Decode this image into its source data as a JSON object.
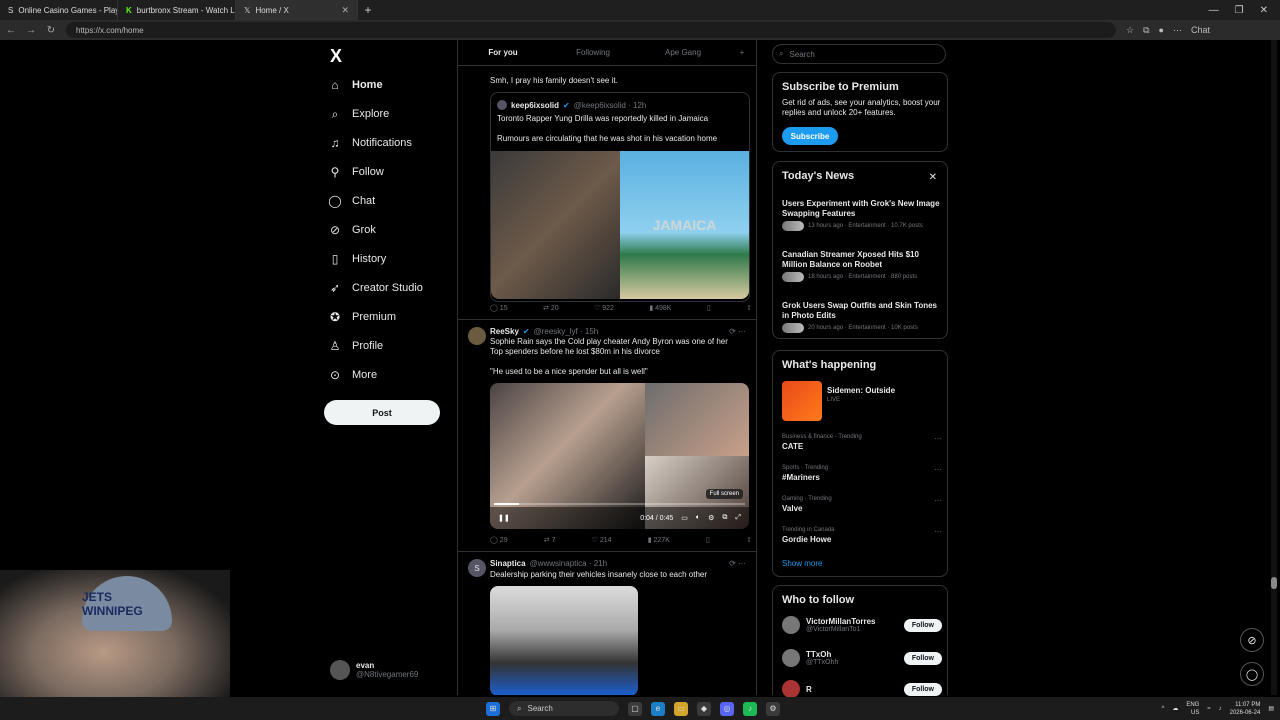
{
  "browser": {
    "tabs": [
      {
        "label": "Online Casino Games - Play Free !",
        "icon": "s-icon"
      },
      {
        "label": "burtbronx Stream - Watch Li...",
        "icon": "kick-icon"
      },
      {
        "label": "Home / X",
        "icon": "x-icon"
      }
    ],
    "url": "https://x.com/home",
    "chat_label": "Chat"
  },
  "sidebar": {
    "logo": "X",
    "items": [
      {
        "label": "Home",
        "icon": "home-icon"
      },
      {
        "label": "Explore",
        "icon": "search-icon"
      },
      {
        "label": "Notifications",
        "icon": "bell-icon"
      },
      {
        "label": "Follow",
        "icon": "person-add-icon"
      },
      {
        "label": "Chat",
        "icon": "chat-icon"
      },
      {
        "label": "Grok",
        "icon": "grok-icon"
      },
      {
        "label": "History",
        "icon": "bookmark-icon"
      },
      {
        "label": "Creator Studio",
        "icon": "rocket-icon"
      },
      {
        "label": "Premium",
        "icon": "premium-icon"
      },
      {
        "label": "Profile",
        "icon": "person-icon"
      },
      {
        "label": "More",
        "icon": "more-icon"
      }
    ],
    "post_label": "Post",
    "account": {
      "name": "evan",
      "handle": "@N8tivegamer69"
    }
  },
  "timeline": {
    "tabs": [
      "For you",
      "Following",
      "Ape Gang"
    ],
    "tweet1": {
      "text": "Smh, I pray his family doesn't see it.",
      "quote": {
        "name": "keep6ixsolid",
        "handle": "@keep6ixsolid · 12h",
        "line1": "Toronto Rapper Yung Drilla was reportedly killed in Jamaica",
        "line2": "Rumours are circulating that he was shot in his vacation home",
        "image_text": "JAMAICA"
      },
      "stats": {
        "replies": "15",
        "reposts": "20",
        "likes": "922",
        "views": "498K"
      }
    },
    "tweet2": {
      "name": "ReeSky",
      "handle": "@reesky_lyf · 15h",
      "line1": "Sophie Rain says the Cold play cheater Andy Byron was one of her Top spenders before he lost $80m in his divorce",
      "line2": "\"He used to be a nice spender but all is well\"",
      "video_time": "0:04 / 0:45",
      "tooltip": "Full screen",
      "progress": 0.1,
      "stats": {
        "replies": "29",
        "reposts": "7",
        "likes": "214",
        "views": "227K"
      }
    },
    "tweet3": {
      "avatar_letter": "S",
      "name": "Sinaptica",
      "handle": "@wwwsinaptica · 21h",
      "text": "Dealership parking their vehicles insanely close to each other"
    }
  },
  "right": {
    "search_placeholder": "Search",
    "premium": {
      "title": "Subscribe to Premium",
      "desc": "Get rid of ads, see your analytics, boost your replies and unlock 20+ features.",
      "button": "Subscribe"
    },
    "news": {
      "title": "Today's News",
      "items": [
        {
          "title": "Users Experiment with Grok's New Image Swapping Features",
          "meta": "13 hours ago · Entertainment · 10.7K posts"
        },
        {
          "title": "Canadian Streamer Xposed Hits $10 Million Balance on Roobet",
          "meta": "18 hours ago · Entertainment · 880 posts"
        },
        {
          "title": "Grok Users Swap Outfits and Skin Tones in Photo Edits",
          "meta": "20 hours ago · Entertainment · 10K posts"
        }
      ]
    },
    "happening": {
      "title": "What's happening",
      "live_title": "Sidemen: Outside",
      "live_tag": "LIVE",
      "trends": [
        {
          "category": "Business & finance · Trending",
          "name": "CATE"
        },
        {
          "category": "Sports · Trending",
          "name": "#Mariners"
        },
        {
          "category": "Gaming · Trending",
          "name": "Valve"
        },
        {
          "category": "Trending in Canada",
          "name": "Gordie Howe"
        }
      ],
      "show_more": "Show more"
    },
    "who_to_follow": {
      "title": "Who to follow",
      "users": [
        {
          "name": "VictorMillanTorres",
          "handle": "@VictorMillanTo1",
          "button": "Follow"
        },
        {
          "name": "TTxOh",
          "handle": "@TTxOhh",
          "button": "Follow"
        },
        {
          "name": "R",
          "handle": "",
          "button": "Follow"
        }
      ]
    }
  },
  "webcam": {
    "cap_text": "JETS WINNIPEG"
  },
  "taskbar": {
    "search": "Search",
    "lang": "ENG",
    "region": "US",
    "time": "11:07 PM",
    "date": "2026-06-24"
  }
}
